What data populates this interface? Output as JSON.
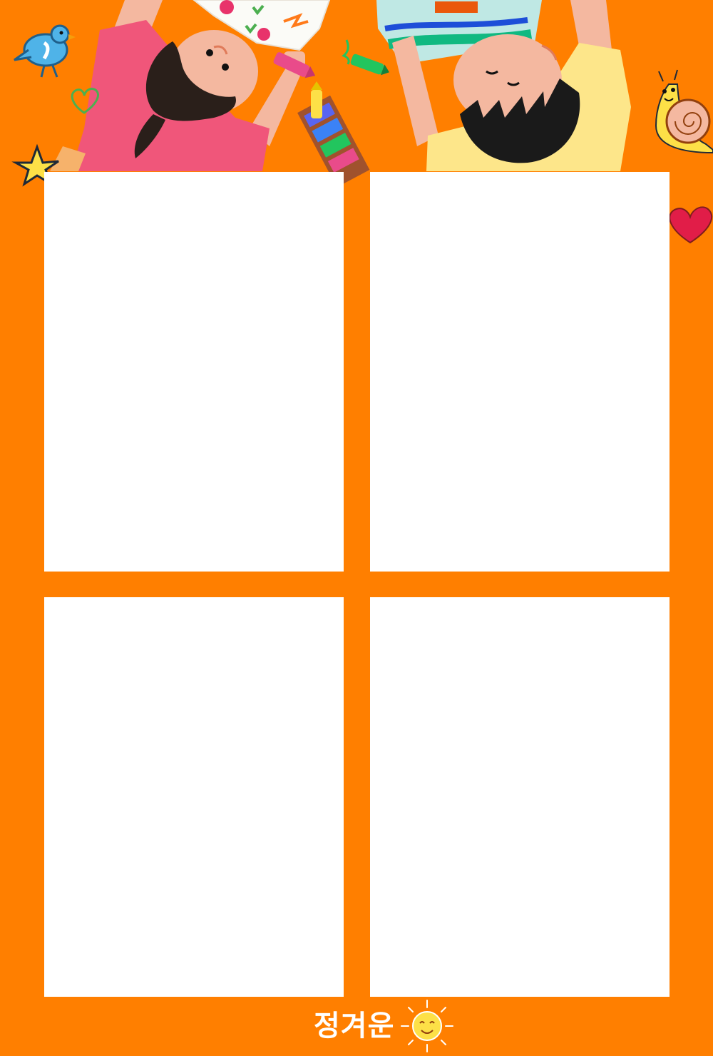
{
  "brand": {
    "text": "정겨운"
  },
  "photo_slots": 4,
  "colors": {
    "background": "#ff7f00",
    "slot": "#ffffff",
    "girl_shirt": "#f0567a",
    "boy_shirt": "#fde68a",
    "hair": "#2a1f1a",
    "skin": "#f4b8a0",
    "sun": "#fde047"
  },
  "icons": [
    "bird-icon",
    "heart-outline-icon",
    "star-icon",
    "crayon-box-icon",
    "crayon-icon",
    "snail-icon",
    "heart-icon",
    "sun-face-icon"
  ]
}
